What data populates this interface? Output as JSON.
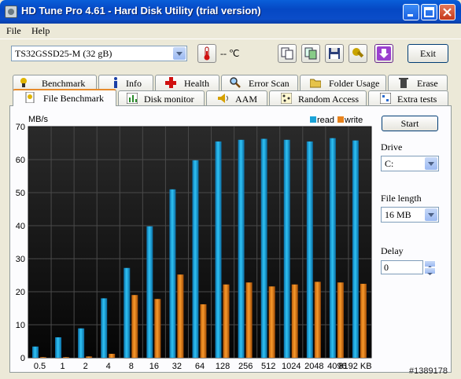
{
  "window": {
    "title": "HD Tune Pro 4.61 - Hard Disk Utility (trial version)"
  },
  "menu": {
    "file": "File",
    "help": "Help"
  },
  "toolbar": {
    "drive": "TS32GSSD25-M (32 gB)",
    "temperature": "-- ℃",
    "exit_label": "Exit"
  },
  "tabs_row1": [
    {
      "label": "Benchmark",
      "icon": "benchmark-icon"
    },
    {
      "label": "Info",
      "icon": "info-icon"
    },
    {
      "label": "Health",
      "icon": "health-icon"
    },
    {
      "label": "Error Scan",
      "icon": "magnifier-icon"
    },
    {
      "label": "Folder Usage",
      "icon": "folder-icon"
    },
    {
      "label": "Erase",
      "icon": "trash-icon"
    }
  ],
  "tabs_row2": [
    {
      "label": "File Benchmark",
      "icon": "file-benchmark-icon",
      "active": true
    },
    {
      "label": "Disk monitor",
      "icon": "disk-monitor-icon"
    },
    {
      "label": "AAM",
      "icon": "speaker-icon"
    },
    {
      "label": "Random Access",
      "icon": "random-access-icon"
    },
    {
      "label": "Extra tests",
      "icon": "extra-tests-icon"
    }
  ],
  "side": {
    "start_label": "Start",
    "drive_label": "Drive",
    "drive_value": "C:",
    "file_length_label": "File length",
    "file_length_value": "16 MB",
    "delay_label": "Delay",
    "delay_value": "0"
  },
  "watermark": "#1389178",
  "chart_data": {
    "type": "bar",
    "ylabel": "MB/s",
    "ylim": [
      0,
      70
    ],
    "yticks": [
      0,
      10,
      20,
      30,
      40,
      50,
      60,
      70
    ],
    "categories": [
      "0.5",
      "1",
      "2",
      "4",
      "8",
      "16",
      "32",
      "64",
      "128",
      "256",
      "512",
      "1024",
      "2048",
      "4096",
      "8192 KB"
    ],
    "series": [
      {
        "name": "read",
        "color": "#1aa3d8",
        "values": [
          3.4,
          6.2,
          8.9,
          18,
          27.2,
          39.8,
          51,
          59.8,
          65.5,
          66,
          66.3,
          66,
          65.5,
          66.5,
          65.8
        ]
      },
      {
        "name": "write",
        "color": "#e8821c",
        "values": [
          0.2,
          0.2,
          0.4,
          1.2,
          19,
          17.8,
          25.2,
          16.2,
          22.2,
          22.8,
          21.6,
          22.2,
          23,
          22.8,
          22.4
        ]
      }
    ],
    "legend": "top-right",
    "grid": true
  }
}
